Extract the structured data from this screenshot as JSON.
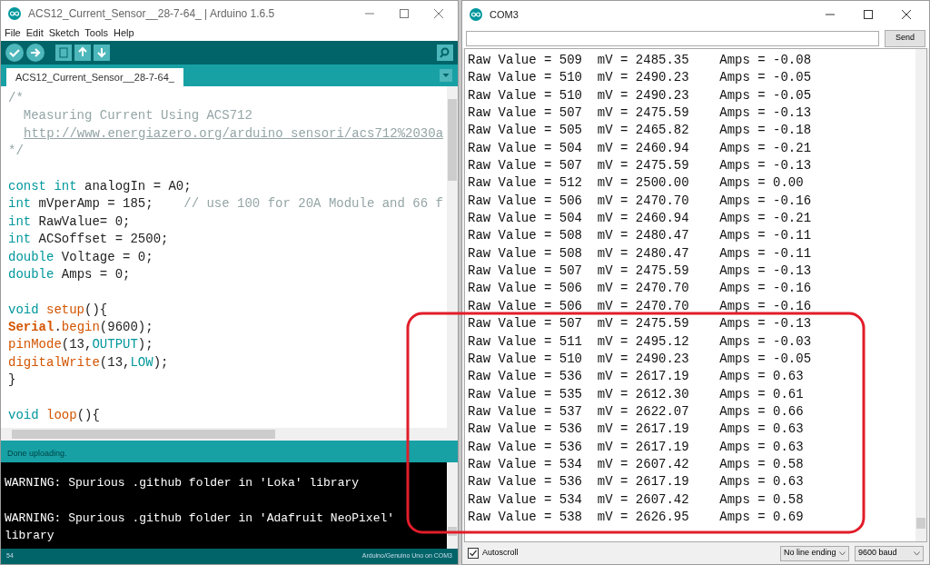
{
  "ide": {
    "window": {
      "title": "ACS12_Current_Sensor__28-7-64_ | Arduino 1.6.5"
    },
    "menu": [
      "File",
      "Edit",
      "Sketch",
      "Tools",
      "Help"
    ],
    "tabs": [
      {
        "label": "ACS12_Current_Sensor__28-7-64_",
        "selected": true
      }
    ],
    "code_lines": [
      {
        "kind": "code",
        "segments": [
          {
            "kind": "comment",
            "text": "/*"
          }
        ]
      },
      {
        "kind": "code",
        "segments": [
          {
            "kind": "comment",
            "text": "  Measuring Current Using ACS712"
          }
        ]
      },
      {
        "kind": "link",
        "text": "http://www.energiazero.org/arduino_sensori/acs712%2030a"
      },
      {
        "kind": "code",
        "segments": [
          {
            "kind": "comment",
            "text": "*/"
          }
        ]
      },
      {
        "kind": "blank"
      },
      {
        "kind": "code",
        "segments": [
          {
            "kind": "keyword",
            "text": "const int"
          },
          {
            "kind": "plain",
            "text": " analogIn = A0;"
          }
        ]
      },
      {
        "kind": "code",
        "segments": [
          {
            "kind": "keyword",
            "text": "int"
          },
          {
            "kind": "plain",
            "text": " mVperAmp = 185;    "
          },
          {
            "kind": "comment",
            "text": "// use 100 for 20A Module and 66 f"
          }
        ]
      },
      {
        "kind": "code",
        "segments": [
          {
            "kind": "keyword",
            "text": "int"
          },
          {
            "kind": "plain",
            "text": " RawValue= 0;"
          }
        ]
      },
      {
        "kind": "code",
        "segments": [
          {
            "kind": "keyword",
            "text": "int"
          },
          {
            "kind": "plain",
            "text": " ACSoffset = 2500;"
          }
        ]
      },
      {
        "kind": "code",
        "segments": [
          {
            "kind": "keyword",
            "text": "double"
          },
          {
            "kind": "plain",
            "text": " Voltage = 0;"
          }
        ]
      },
      {
        "kind": "code",
        "segments": [
          {
            "kind": "keyword",
            "text": "double"
          },
          {
            "kind": "plain",
            "text": " Amps = 0;"
          }
        ]
      },
      {
        "kind": "blank"
      },
      {
        "kind": "code",
        "segments": [
          {
            "kind": "keyword",
            "text": "void "
          },
          {
            "kind": "function",
            "text": "setup"
          },
          {
            "kind": "plain",
            "text": "(){"
          }
        ]
      },
      {
        "kind": "code",
        "segments": [
          {
            "kind": "class",
            "text": "Serial"
          },
          {
            "kind": "plain",
            "text": "."
          },
          {
            "kind": "function",
            "text": "begin"
          },
          {
            "kind": "plain",
            "text": "(9600);"
          }
        ]
      },
      {
        "kind": "code",
        "segments": [
          {
            "kind": "function",
            "text": "pinMode"
          },
          {
            "kind": "plain",
            "text": "(13,"
          },
          {
            "kind": "keyword",
            "text": "OUTPUT"
          },
          {
            "kind": "plain",
            "text": ");"
          }
        ]
      },
      {
        "kind": "code",
        "segments": [
          {
            "kind": "function",
            "text": "digitalWrite"
          },
          {
            "kind": "plain",
            "text": "(13,"
          },
          {
            "kind": "keyword",
            "text": "LOW"
          },
          {
            "kind": "plain",
            "text": ");"
          }
        ]
      },
      {
        "kind": "code",
        "segments": [
          {
            "kind": "plain",
            "text": "}"
          }
        ]
      },
      {
        "kind": "blank"
      },
      {
        "kind": "code",
        "segments": [
          {
            "kind": "keyword",
            "text": "void "
          },
          {
            "kind": "function",
            "text": "loop"
          },
          {
            "kind": "plain",
            "text": "(){"
          }
        ]
      }
    ],
    "status": "Done uploading.",
    "console_lines": [
      {
        "kind": "text",
        "text": "WARNING: Spurious .github folder in 'Loka' library"
      },
      {
        "kind": "blank"
      },
      {
        "kind": "text",
        "text": "WARNING: Spurious .github folder in 'Adafruit NeoPixel'"
      },
      {
        "kind": "text",
        "text": "library"
      }
    ],
    "footer": {
      "line": "54",
      "board": "Arduino/Genuino Uno on COM3"
    }
  },
  "serial_monitor": {
    "window": {
      "title": "COM3"
    },
    "send_button": "Send",
    "lines": [
      "Raw Value = 509  mV = 2485.35    Amps = -0.08",
      "Raw Value = 510  mV = 2490.23    Amps = -0.05",
      "Raw Value = 510  mV = 2490.23    Amps = -0.05",
      "Raw Value = 507  mV = 2475.59    Amps = -0.13",
      "Raw Value = 505  mV = 2465.82    Amps = -0.18",
      "Raw Value = 504  mV = 2460.94    Amps = -0.21",
      "Raw Value = 507  mV = 2475.59    Amps = -0.13",
      "Raw Value = 512  mV = 2500.00    Amps = 0.00",
      "Raw Value = 506  mV = 2470.70    Amps = -0.16",
      "Raw Value = 504  mV = 2460.94    Amps = -0.21",
      "Raw Value = 508  mV = 2480.47    Amps = -0.11",
      "Raw Value = 508  mV = 2480.47    Amps = -0.11",
      "Raw Value = 507  mV = 2475.59    Amps = -0.13",
      "Raw Value = 506  mV = 2470.70    Amps = -0.16",
      "Raw Value = 506  mV = 2470.70    Amps = -0.16",
      "Raw Value = 507  mV = 2475.59    Amps = -0.13",
      "Raw Value = 511  mV = 2495.12    Amps = -0.03",
      "Raw Value = 510  mV = 2490.23    Amps = -0.05",
      "Raw Value = 536  mV = 2617.19    Amps = 0.63",
      "Raw Value = 535  mV = 2612.30    Amps = 0.61",
      "Raw Value = 537  mV = 2622.07    Amps = 0.66",
      "Raw Value = 536  mV = 2617.19    Amps = 0.63",
      "Raw Value = 536  mV = 2617.19    Amps = 0.63",
      "Raw Value = 534  mV = 2607.42    Amps = 0.58",
      "Raw Value = 536  mV = 2617.19    Amps = 0.63",
      "Raw Value = 534  mV = 2607.42    Amps = 0.58",
      "Raw Value = 538  mV = 2626.95    Amps = 0.69"
    ],
    "autoscroll": {
      "label": "Autoscroll",
      "checked": true
    },
    "line_ending": "No line ending",
    "baud": "9600 baud"
  }
}
